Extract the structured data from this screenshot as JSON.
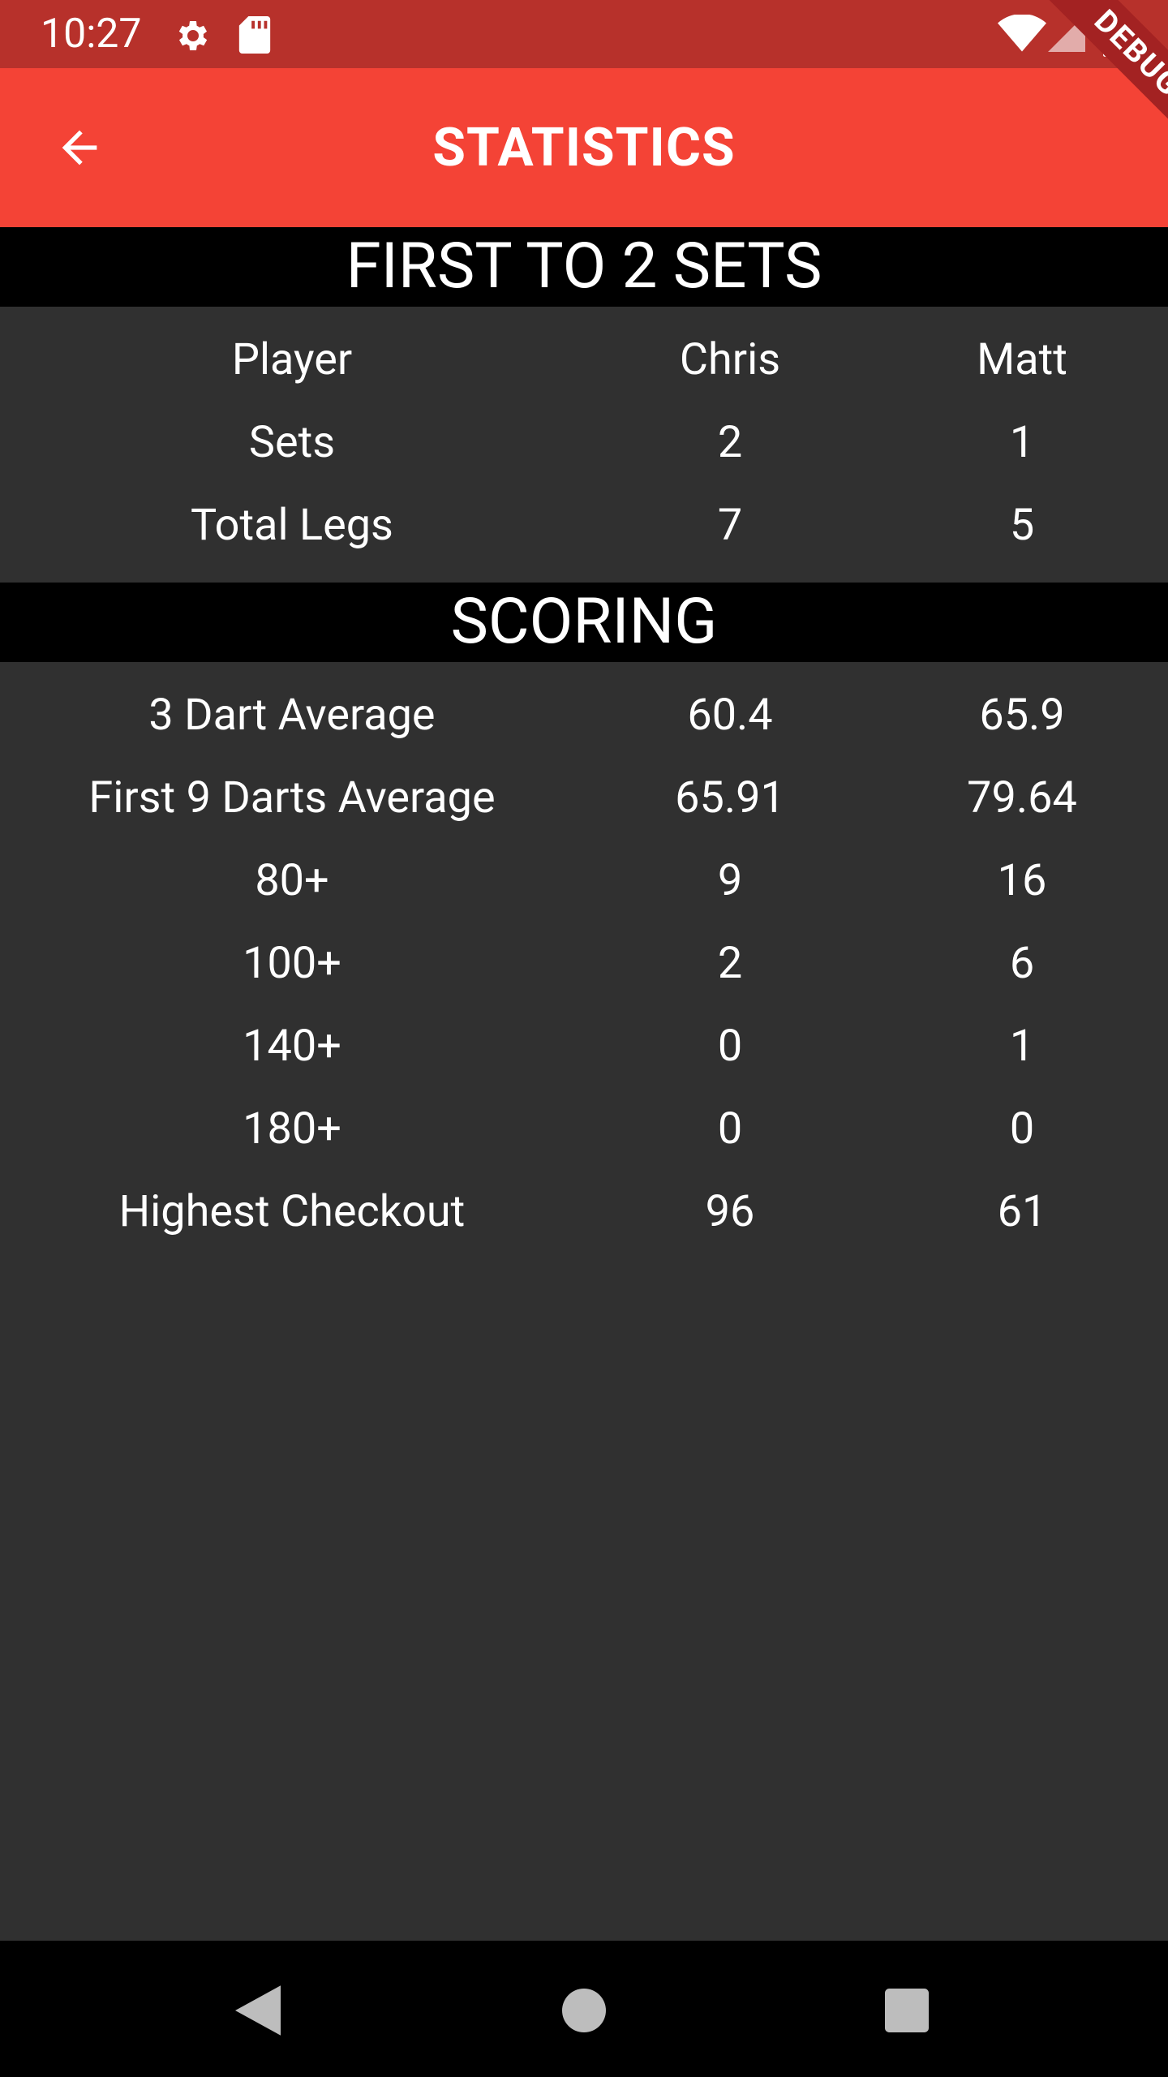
{
  "status_bar": {
    "time": "10:27",
    "icons": [
      "settings-gear-icon",
      "sd-card-icon",
      "wifi-icon",
      "cell-signal-icon",
      "battery-icon"
    ]
  },
  "app_bar": {
    "title": "STATISTICS",
    "back_icon": "arrow-back-icon",
    "debug_label": "DEBUG",
    "color": "#f44336"
  },
  "match": {
    "header": "FIRST TO 2 SETS",
    "rows": [
      {
        "label": "Player",
        "p1": "Chris",
        "p2": "Matt"
      },
      {
        "label": "Sets",
        "p1": "2",
        "p2": "1"
      },
      {
        "label": "Total Legs",
        "p1": "7",
        "p2": "5"
      }
    ]
  },
  "scoring": {
    "header": "SCORING",
    "rows": [
      {
        "label": "3 Dart Average",
        "p1": "60.4",
        "p2": "65.9"
      },
      {
        "label": "First 9 Darts Average",
        "p1": "65.91",
        "p2": "79.64"
      },
      {
        "label": "80+",
        "p1": "9",
        "p2": "16"
      },
      {
        "label": "100+",
        "p1": "2",
        "p2": "6"
      },
      {
        "label": "140+",
        "p1": "0",
        "p2": "1"
      },
      {
        "label": "180+",
        "p1": "0",
        "p2": "0"
      },
      {
        "label": "Highest Checkout",
        "p1": "96",
        "p2": "61"
      }
    ]
  },
  "nav_bar": {
    "icons": [
      "nav-back-icon",
      "nav-home-icon",
      "nav-recents-icon"
    ]
  }
}
